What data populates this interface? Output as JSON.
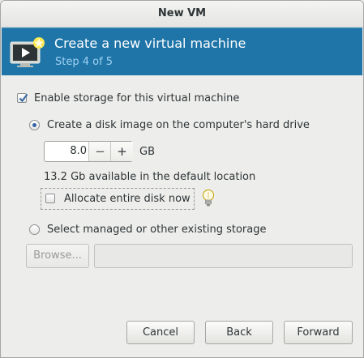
{
  "window": {
    "title": "New VM"
  },
  "banner": {
    "title": "Create a new virtual machine",
    "step": "Step 4 of 5",
    "icon": "vm-monitor-icon"
  },
  "storage": {
    "enable_label": "Enable storage for this virtual machine",
    "enable_checked": true,
    "create_disk_label": "Create a disk image on the computer's hard drive",
    "create_disk_selected": true,
    "size_value": "8.0",
    "size_unit": "GB",
    "available_text": "13.2 Gb available in the default location",
    "allocate_label": "Allocate entire disk now",
    "allocate_checked": false,
    "managed_label": "Select managed or other existing storage",
    "managed_selected": false,
    "browse_label": "Browse...",
    "path_value": ""
  },
  "buttons": {
    "cancel": "Cancel",
    "back": "Back",
    "forward": "Forward"
  },
  "colors": {
    "banner_bg": "#1f75a8",
    "banner_subtitle": "#9fd2f2",
    "accent": "#3465a4"
  }
}
